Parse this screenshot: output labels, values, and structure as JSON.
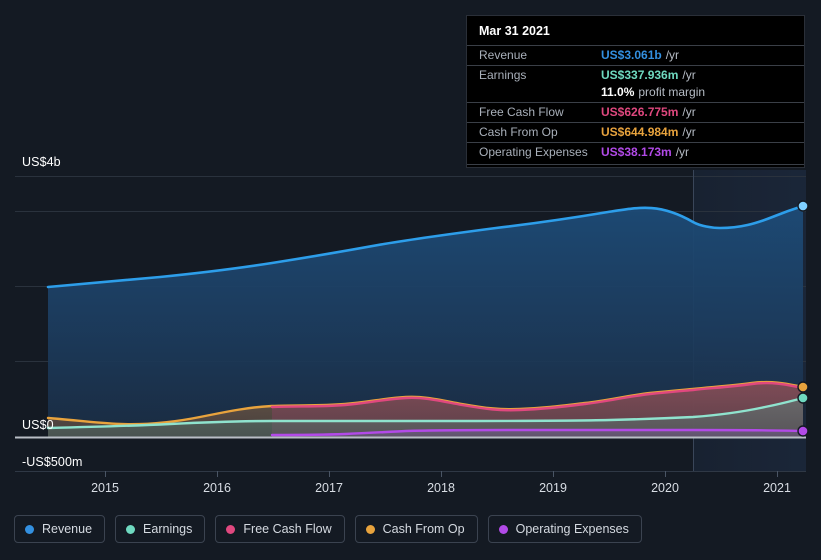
{
  "colors": {
    "revenue": "#3390e0",
    "earnings": "#6fd9c0",
    "free_cash_flow": "#e0487f",
    "cash_from_op": "#e8a33d",
    "operating_expenses": "#b24ae8",
    "background": "#141a23",
    "grid": "#2a323d",
    "zero_line": "#b9bec6"
  },
  "tooltip": {
    "date": "Mar 31 2021",
    "rows": [
      {
        "key": "Revenue",
        "value": "US$3.061b",
        "unit": "/yr",
        "color": "#3390e0"
      },
      {
        "key": "Earnings",
        "value": "US$337.936m",
        "unit": "/yr",
        "color": "#6fd9c0"
      },
      {
        "key": "",
        "value": "11.0%",
        "unit": "profit margin",
        "color": "#ffffff"
      },
      {
        "key": "Free Cash Flow",
        "value": "US$626.775m",
        "unit": "/yr",
        "color": "#e0487f"
      },
      {
        "key": "Cash From Op",
        "value": "US$644.984m",
        "unit": "/yr",
        "color": "#e8a33d"
      },
      {
        "key": "Operating Expenses",
        "value": "US$38.173m",
        "unit": "/yr",
        "color": "#b24ae8"
      }
    ]
  },
  "legend": [
    {
      "label": "Revenue",
      "color": "#3390e0"
    },
    {
      "label": "Earnings",
      "color": "#6fd9c0"
    },
    {
      "label": "Free Cash Flow",
      "color": "#e0487f"
    },
    {
      "label": "Cash From Op",
      "color": "#e8a33d"
    },
    {
      "label": "Operating Expenses",
      "color": "#b24ae8"
    }
  ],
  "axis": {
    "y_top_label": "US$4b",
    "y_zero_label": "US$0",
    "y_bottom_label": "-US$500m",
    "x_ticks": [
      "2015",
      "2016",
      "2017",
      "2018",
      "2019",
      "2020",
      "2021"
    ]
  },
  "chart_data": {
    "type": "area",
    "title": "",
    "xlabel": "",
    "ylabel": "",
    "ylim": [
      -500000000,
      4000000000
    ],
    "y_tick_values": [
      4000000000,
      0,
      -500000000
    ],
    "y_tick_labels": [
      "US$4b",
      "US$0",
      "-US$500m"
    ],
    "x": [
      "2014.4",
      "2014.7",
      "2015.0",
      "2015.3",
      "2015.6",
      "2015.9",
      "2016.2",
      "2016.5",
      "2016.8",
      "2017.1",
      "2017.4",
      "2017.7",
      "2018.0",
      "2018.3",
      "2018.6",
      "2018.9",
      "2019.2",
      "2019.5",
      "2019.8",
      "2020.1",
      "2020.4",
      "2020.7",
      "2021.0",
      "2021.25"
    ],
    "categories": [
      "2015",
      "2016",
      "2017",
      "2018",
      "2019",
      "2020",
      "2021"
    ],
    "grid": true,
    "legend_position": "bottom",
    "units": "USD",
    "forecast_divider_x": "2020.45",
    "series": [
      {
        "name": "Revenue",
        "color": "#3390e0",
        "unit": "USD",
        "final_value": 3061000000,
        "final_label": "US$3.061b",
        "values": [
          2000000000,
          2020000000,
          2040000000,
          2065000000,
          2090000000,
          2140000000,
          2190000000,
          2245000000,
          2300000000,
          2340000000,
          2380000000,
          2430000000,
          2480000000,
          2530000000,
          2580000000,
          2620000000,
          2690000000,
          2760000000,
          2830000000,
          2905000000,
          2850000000,
          2840000000,
          2950000000,
          3061000000
        ]
      },
      {
        "name": "Earnings",
        "color": "#6fd9c0",
        "unit": "USD",
        "final_value": 337936000,
        "final_label": "US$337.936m",
        "profit_margin": "11.0%",
        "values": [
          130000000,
          135000000,
          140000000,
          148000000,
          155000000,
          160000000,
          162000000,
          163000000,
          162000000,
          161000000,
          160000000,
          159000000,
          158000000,
          158000000,
          157000000,
          157000000,
          158000000,
          160000000,
          163000000,
          170000000,
          185000000,
          215000000,
          275000000,
          337936000
        ]
      },
      {
        "name": "Free Cash Flow",
        "color": "#e0487f",
        "unit": "USD",
        "final_value": 626775000,
        "final_label": "US$626.775m",
        "values": [
          null,
          null,
          null,
          null,
          null,
          null,
          245000000,
          250000000,
          260000000,
          268000000,
          300000000,
          320000000,
          285000000,
          265000000,
          268000000,
          282000000,
          330000000,
          360000000,
          370000000,
          378000000,
          400000000,
          460000000,
          545000000,
          626775000
        ]
      },
      {
        "name": "Cash From Op",
        "color": "#e8a33d",
        "unit": "USD",
        "final_value": 644984000,
        "final_label": "US$644.984m",
        "values": [
          250000000,
          240000000,
          228000000,
          218000000,
          216000000,
          240000000,
          272000000,
          280000000,
          292000000,
          282000000,
          300000000,
          330000000,
          300000000,
          278000000,
          280000000,
          292000000,
          340000000,
          372000000,
          382000000,
          390000000,
          412000000,
          472000000,
          558000000,
          644984000
        ]
      },
      {
        "name": "Operating Expenses",
        "color": "#b24ae8",
        "unit": "USD",
        "final_value": 38173000,
        "final_label": "US$38.173m",
        "values": [
          null,
          null,
          null,
          null,
          null,
          null,
          null,
          20000000,
          22000000,
          24000000,
          30000000,
          37000000,
          40000000,
          41000000,
          41000000,
          41000000,
          42000000,
          42000000,
          42000000,
          42000000,
          41000000,
          40000000,
          39000000,
          38173000
        ]
      }
    ]
  }
}
